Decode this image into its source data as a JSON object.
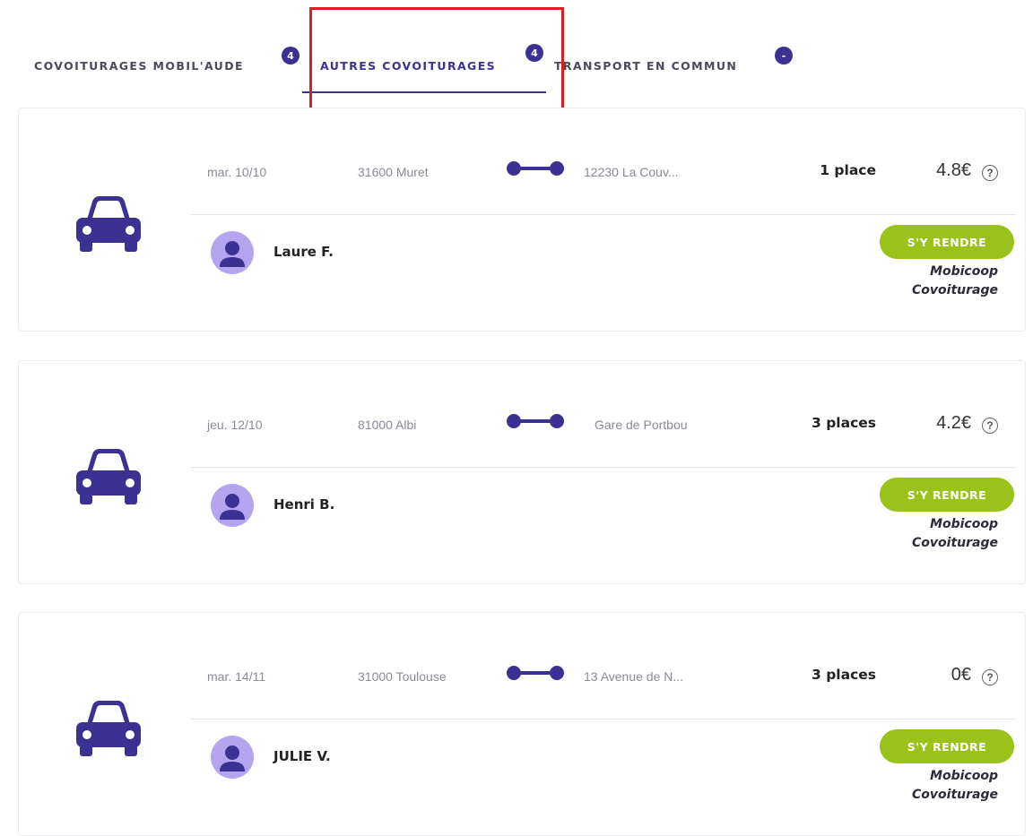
{
  "tabs": [
    {
      "label": "COVOITURAGES MOBIL'AUDE",
      "badge": "4",
      "active": false
    },
    {
      "label": "AUTRES COVOITURAGES",
      "badge": "4",
      "active": true
    },
    {
      "label": "TRANSPORT EN COMMUN",
      "badge": "-",
      "active": false
    }
  ],
  "colors": {
    "primary": "#3b3192",
    "accent_green": "#99c21a",
    "avatar_bg": "#b5a4f0",
    "highlight_red": "#d42027"
  },
  "results": [
    {
      "date": "mar. 10/10",
      "origin": "31600 Muret",
      "destination": "12230 La Couv...",
      "seats": "1 place",
      "price": "4.8€",
      "help": "?",
      "driver": "Laure F.",
      "action": "S'Y RENDRE",
      "provider_line1": "Mobicoop",
      "provider_line2": "Covoiturage"
    },
    {
      "date": "jeu. 12/10",
      "origin": "81000 Albi",
      "destination": "Gare de Portbou",
      "seats": "3 places",
      "price": "4.2€",
      "help": "?",
      "driver": "Henri B.",
      "action": "S'Y RENDRE",
      "provider_line1": "Mobicoop",
      "provider_line2": "Covoiturage"
    },
    {
      "date": "mar. 14/11",
      "origin": "31000 Toulouse",
      "destination": "13 Avenue de N...",
      "seats": "3 places",
      "price": "0€",
      "help": "?",
      "driver": "JULIE V.",
      "action": "S'Y RENDRE",
      "provider_line1": "Mobicoop",
      "provider_line2": "Covoiturage"
    }
  ]
}
